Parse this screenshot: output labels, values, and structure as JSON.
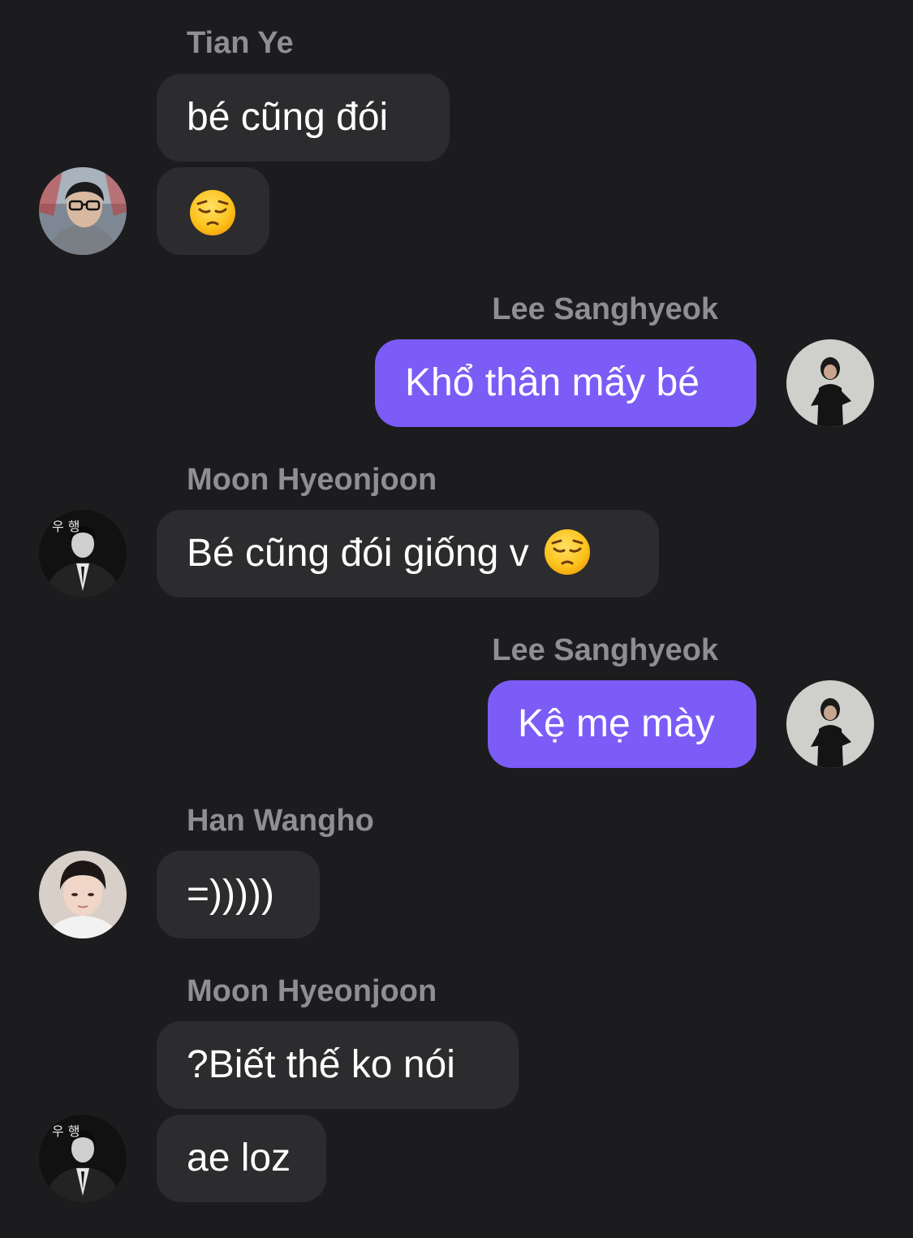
{
  "messages": [
    {
      "sender": "Tian Ye",
      "text": "bé cũng đói"
    },
    {
      "sender": "Tian Ye",
      "emoji": "pensive-face"
    },
    {
      "sender": "Lee Sanghyeok",
      "text": "Khổ thân mấy bé"
    },
    {
      "sender": "Moon Hyeonjoon",
      "text": "Bé cũng đói giống v",
      "emoji": "pensive-face"
    },
    {
      "sender": "Lee Sanghyeok",
      "text": "Kệ mẹ mày"
    },
    {
      "sender": "Han Wangho",
      "text": "=)))))"
    },
    {
      "sender": "Moon Hyeonjoon",
      "text": "?Biết thế ko nói"
    },
    {
      "sender": "Moon Hyeonjoon",
      "text": "ae loz"
    }
  ],
  "avatar_watermark": "우 행",
  "colors": {
    "background": "#1c1c1e",
    "incoming_bubble": "#2c2c2e",
    "outgoing_bubble": "#7b5cf6",
    "sender_name": "#8e8e93",
    "message_text": "#ffffff"
  }
}
